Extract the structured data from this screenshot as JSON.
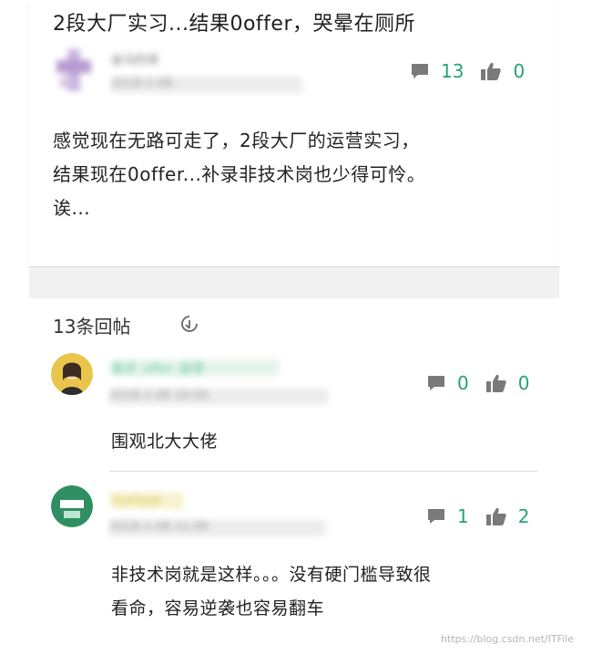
{
  "post": {
    "title": "2段大厂实习...结果0offer，哭晕在厕所",
    "author": "金马的球",
    "date": "2018-1-08",
    "comments": "13",
    "likes": "0",
    "body_lines": [
      "感觉现在无路可走了，2段大厂的运营实习，",
      "结果现在0offer...补录非技术岗也少得可怜。",
      "诶..."
    ]
  },
  "replies_header": "13条回帖",
  "replies": [
    {
      "author": "路求_offer_直营",
      "date": "2018-1-08 10:00",
      "comments": "0",
      "likes": "0",
      "content_lines": [
        "围观北大大佬"
      ]
    },
    {
      "author": "liuxiaya",
      "date": "2018-1-08 11:00",
      "comments": "1",
      "likes": "2",
      "content_lines": [
        "非技术岗就是这样。。。没有硬门槛导致很",
        "看命，容易逆袭也容易翻车"
      ]
    }
  ],
  "watermark": "https://blog.csdn.net/ITFile",
  "colors": {
    "accent": "#26a17b",
    "icon": "#7a7a7a"
  }
}
